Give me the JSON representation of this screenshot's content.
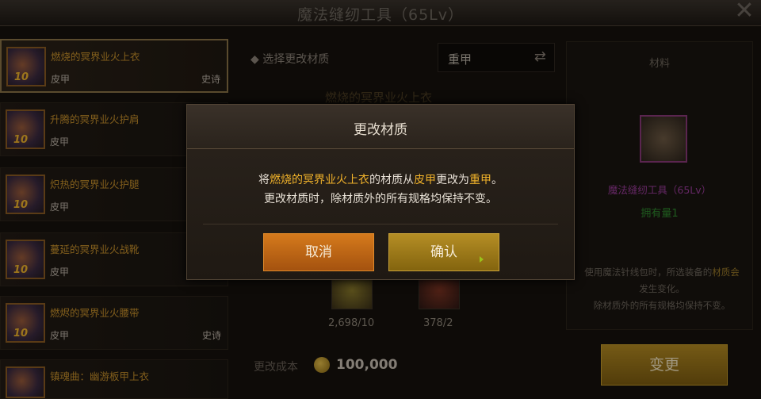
{
  "window": {
    "title": "魔法缝纫工具（65Lv）"
  },
  "list": {
    "items": [
      {
        "name": "燃烧的冥界业火上衣",
        "type": "皮甲",
        "tag": "史诗",
        "level": "10"
      },
      {
        "name": "升腾的冥界业火护肩",
        "type": "皮甲",
        "tag": "",
        "level": "10"
      },
      {
        "name": "炽热的冥界业火护腿",
        "type": "皮甲",
        "tag": "",
        "level": "10"
      },
      {
        "name": "蔓延的冥界业火战靴",
        "type": "皮甲",
        "tag": "",
        "level": "10"
      },
      {
        "name": "燃烬的冥界业火腰带",
        "type": "皮甲",
        "tag": "史诗",
        "level": "10"
      },
      {
        "name": "镇魂曲：幽游板甲上衣",
        "type": "",
        "tag": "",
        "level": ""
      }
    ]
  },
  "selector": {
    "heading": "◆ 选择更改材质",
    "value": "重甲",
    "swap_icon": "⇄"
  },
  "center": {
    "faded_title": "燃烧的冥界业火上衣",
    "mat1_count": "2,698/10",
    "mat2_count": "378/2"
  },
  "cost": {
    "label": "更改成本",
    "value": "100,000"
  },
  "right": {
    "header": "材料",
    "name": "魔法缝纫工具（65Lv）",
    "owned": "拥有量1",
    "desc_a": "使用魔法针线包时，所选装备的",
    "desc_hl": "材质会",
    "desc_b": "发生变化。",
    "desc_c": "除材质外的所有规格均保持不变。",
    "change_label": "变更"
  },
  "dialog": {
    "title": "更改材质",
    "p1": "将",
    "item": "燃烧的冥界业火上衣",
    "p2": "的材质从",
    "from": "皮甲",
    "p3": "更改为",
    "to": "重甲",
    "p4": "。",
    "line2": "更改材质时，除材质外的所有规格均保持不变。",
    "cancel": "取消",
    "confirm": "确认"
  }
}
